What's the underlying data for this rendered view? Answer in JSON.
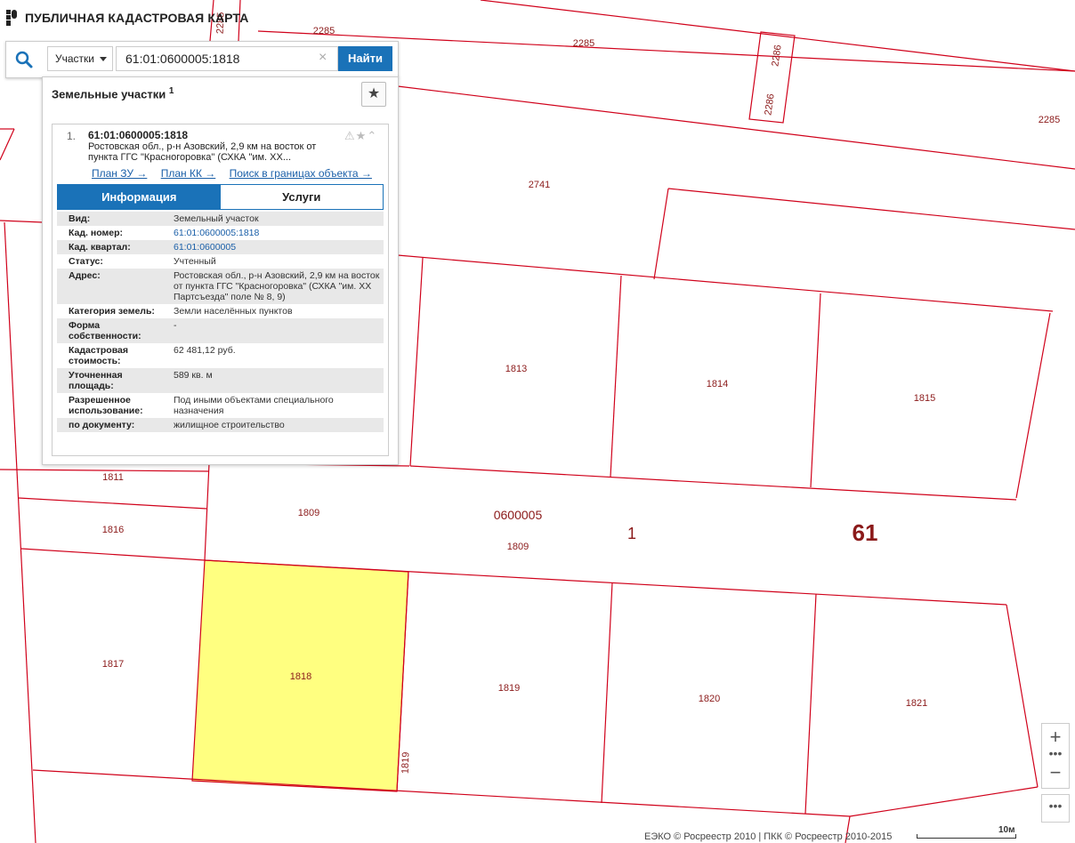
{
  "header": {
    "title": "ПУБЛИЧНАЯ КАДАСТРОВАЯ КАРТА"
  },
  "search": {
    "type_select": "Участки",
    "query": "61:01:0600005:1818",
    "find_label": "Найти",
    "clear_symbol": "×"
  },
  "panel": {
    "title": "Земельные участки",
    "count": "1",
    "result": {
      "index": "1.",
      "cad_number": "61:01:0600005:1818",
      "address_short": "Ростовская обл., р-н Азовский, 2,9 км на восток от пункта ГГС \"Красногоровка\" (СХКА \"им. XX...",
      "links": [
        "План ЗУ →",
        "План КК →",
        "Поиск в границах объекта →"
      ],
      "tabs": {
        "info": "Информация",
        "services": "Услуги"
      },
      "rows": [
        {
          "key": "Вид:",
          "value": "Земельный участок"
        },
        {
          "key": "Кад. номер:",
          "value": "61:01:0600005:1818"
        },
        {
          "key": "Кад. квартал:",
          "value": "61:01:0600005"
        },
        {
          "key": "Статус:",
          "value": "Учтенный"
        },
        {
          "key": "Адрес:",
          "value": "Ростовская обл., р-н Азовский, 2,9 км на восток от пункта ГГС \"Красногоровка\" (СХКА \"им. XX Партсъезда\" поле № 8, 9)"
        },
        {
          "key": "Категория земель:",
          "value": "Земли населённых пунктов"
        },
        {
          "key": "Форма собственности:",
          "value": "-"
        },
        {
          "key": "Кадастровая стоимость:",
          "value": "62 481,12 руб."
        },
        {
          "key": "Уточненная площадь:",
          "value": "589 кв. м"
        },
        {
          "key": "Разрешенное использование:",
          "value": "Под иными объектами специального назначения"
        },
        {
          "key": "по документу:",
          "value": "жилищное строительство"
        }
      ]
    }
  },
  "map": {
    "parcel_labels": [
      "2285",
      "2285",
      "2285",
      "2286",
      "2286",
      "2285",
      "2741",
      "1813",
      "1814",
      "1815",
      "1811",
      "1809",
      "1809",
      "1816",
      "1817",
      "1818",
      "1819",
      "1820",
      "1821",
      "1819",
      "2285"
    ],
    "quarter_label": "0600005",
    "area_label": "1",
    "region_label": "61",
    "line_color": "#d0021b",
    "highlight_color": "#ffff80"
  },
  "controls": {
    "zoom_in": "+",
    "zoom_out": "−",
    "more": "•••"
  },
  "footer": {
    "attribution": "ЕЭКО © Росреестр 2010 | ПКК © Росреестр 2010-2015",
    "scale": "10м"
  }
}
